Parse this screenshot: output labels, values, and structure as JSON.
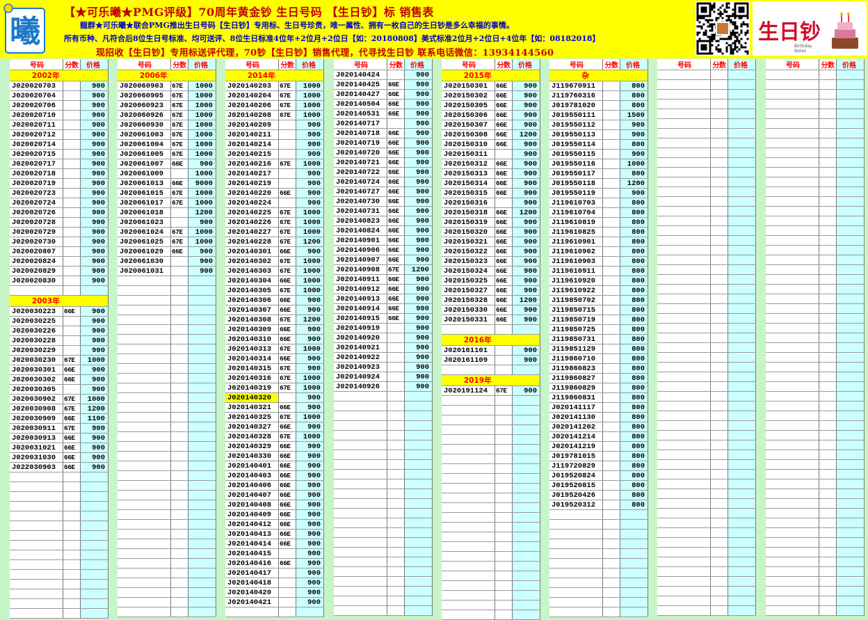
{
  "header": {
    "line1": "【★可乐曦★PMG评级】70周年黄金钞 生日号码  【生日钞】标  销售表",
    "line2": "龍群★可乐曦★联合PMG推出生日号码【生日钞】专用标、生日号珍贵，唯一属性、拥有一枚自己的生日钞是多么幸福的事情。",
    "line3": "所有币种、凡符合后8位生日号标准、均可送评、8位生日标准4位年+2位月+2位日【如：20180808】美式标准2位月+2位日+4位年【如：08182018】",
    "line4": "现招收【生日钞】专用标送评代理，70钞【生日钞】销售代理，代寻找生日钞 联系电话微信：13934144560",
    "logo_left_char": "曦",
    "logo_right_text": "生日钞",
    "logo_right_sub1": "Birthday",
    "logo_right_sub2": "Notes"
  },
  "labels": {
    "code": "号码",
    "score": "分数",
    "price": "价格"
  },
  "columns": [
    {
      "rows": [
        {
          "year": "2002年"
        },
        [
          "J020020703",
          "",
          "900"
        ],
        [
          "J020020704",
          "",
          "900"
        ],
        [
          "J020020706",
          "",
          "900"
        ],
        [
          "J020020710",
          "",
          "900"
        ],
        [
          "J020020711",
          "",
          "900"
        ],
        [
          "J020020712",
          "",
          "900"
        ],
        [
          "J020020714",
          "",
          "900"
        ],
        [
          "J020020715",
          "",
          "900"
        ],
        [
          "J020020717",
          "",
          "900"
        ],
        [
          "J020020718",
          "",
          "900"
        ],
        [
          "J020020719",
          "",
          "900"
        ],
        [
          "J020020723",
          "",
          "900"
        ],
        [
          "J020020724",
          "",
          "900"
        ],
        [
          "J020020726",
          "",
          "900"
        ],
        [
          "J020020728",
          "",
          "900"
        ],
        [
          "J020020729",
          "",
          "900"
        ],
        [
          "J020020730",
          "",
          "900"
        ],
        [
          "J020020807",
          "",
          "900"
        ],
        [
          "J020020824",
          "",
          "900"
        ],
        [
          "J020020829",
          "",
          "900"
        ],
        [
          "J020020830",
          "",
          "900"
        ],
        [
          "",
          "",
          ""
        ],
        {
          "year": "2003年"
        },
        [
          "J020030223",
          "66E",
          "900"
        ],
        [
          "J020030225",
          "",
          "900"
        ],
        [
          "J020030226",
          "",
          "900"
        ],
        [
          "J020030228",
          "",
          "900"
        ],
        [
          "J020030229",
          "",
          "900"
        ],
        [
          "J020030230",
          "67E",
          "1000"
        ],
        [
          "J020030301",
          "66E",
          "900"
        ],
        [
          "J020030302",
          "66E",
          "900"
        ],
        [
          "J020030305",
          "",
          "900"
        ],
        [
          "J020030902",
          "67E",
          "1000"
        ],
        [
          "J020030908",
          "67E",
          "1200"
        ],
        [
          "J020030909",
          "66E",
          "1100"
        ],
        [
          "J020030911",
          "67E",
          "900"
        ],
        [
          "J020030913",
          "66E",
          "900"
        ],
        [
          "J020031021",
          "66E",
          "900"
        ],
        [
          "J020031030",
          "66E",
          "900"
        ],
        [
          "J022030903",
          "66E",
          "900"
        ]
      ]
    },
    {
      "rows": [
        {
          "year": "2006年"
        },
        [
          "J020060903",
          "67E",
          "1000"
        ],
        [
          "J020060905",
          "67E",
          "1000"
        ],
        [
          "J020060923",
          "67E",
          "1000"
        ],
        [
          "J020060926",
          "67E",
          "1000"
        ],
        [
          "J020060930",
          "67E",
          "1000"
        ],
        [
          "J020061003",
          "67E",
          "1000"
        ],
        [
          "J020061004",
          "67E",
          "1000"
        ],
        [
          "J020061005",
          "67E",
          "1000"
        ],
        [
          "J020061007",
          "66E",
          "900"
        ],
        [
          "J020061009",
          "",
          "1000"
        ],
        [
          "J020061013",
          "66E",
          "9000"
        ],
        [
          "J020061015",
          "67E",
          "1000"
        ],
        [
          "J020061017",
          "67E",
          "1000"
        ],
        [
          "J020061018",
          "",
          "1200"
        ],
        [
          "J020061023",
          "",
          "900"
        ],
        [
          "J020061024",
          "67E",
          "1000"
        ],
        [
          "J020061025",
          "67E",
          "1000"
        ],
        [
          "J020061029",
          "66E",
          "900"
        ],
        [
          "J020061030",
          "",
          "900"
        ],
        [
          "J020061031",
          "",
          "900"
        ]
      ]
    },
    {
      "rows": [
        {
          "year": "2014年"
        },
        [
          "J020140203",
          "67E",
          "1000"
        ],
        [
          "J020140204",
          "67E",
          "1000"
        ],
        [
          "J020140206",
          "67E",
          "1000"
        ],
        [
          "J020140208",
          "67E",
          "1000"
        ],
        [
          "J020140209",
          "",
          "900"
        ],
        [
          "J020140211",
          "",
          "900"
        ],
        [
          "J020140214",
          "",
          "900"
        ],
        [
          "J020140215",
          "",
          "900"
        ],
        [
          "J020140216",
          "67E",
          "1000"
        ],
        [
          "J020140217",
          "",
          "900"
        ],
        [
          "J020140219",
          "",
          "900"
        ],
        [
          "J020140220",
          "66E",
          "900"
        ],
        [
          "J020140224",
          "",
          "900"
        ],
        [
          "J020140225",
          "67E",
          "1000"
        ],
        [
          "J020140226",
          "67E",
          "1000"
        ],
        [
          "J020140227",
          "67E",
          "1000"
        ],
        [
          "J020140228",
          "67E",
          "1200"
        ],
        [
          "J020140301",
          "66E",
          "900"
        ],
        [
          "J020140302",
          "67E",
          "1000"
        ],
        [
          "J020140303",
          "67E",
          "1000"
        ],
        [
          "J020140304",
          "66E",
          "1000"
        ],
        [
          "J020140305",
          "67E",
          "1000"
        ],
        [
          "J020140306",
          "66E",
          "900"
        ],
        [
          "J020140307",
          "66E",
          "900"
        ],
        [
          "J020140308",
          "67E",
          "1200"
        ],
        [
          "J020140309",
          "66E",
          "900"
        ],
        [
          "J020140310",
          "66E",
          "900"
        ],
        [
          "J020140313",
          "67E",
          "1000"
        ],
        [
          "J020140314",
          "66E",
          "900"
        ],
        [
          "J020140315",
          "67E",
          "900"
        ],
        [
          "J020140316",
          "67E",
          "1000"
        ],
        [
          "J020140319",
          "67E",
          "1000"
        ],
        [
          "J020140320",
          "",
          "900"
        ],
        [
          "J020140321",
          "66E",
          "900"
        ],
        [
          "J020140325",
          "67E",
          "1000"
        ],
        [
          "J020140327",
          "66E",
          "900"
        ],
        [
          "J020140328",
          "67E",
          "1000"
        ],
        [
          "J020140329",
          "66E",
          "900"
        ],
        [
          "J020140330",
          "66E",
          "900"
        ],
        [
          "J020140401",
          "66E",
          "900"
        ],
        [
          "J020140403",
          "66E",
          "900"
        ],
        [
          "J020140406",
          "66E",
          "900"
        ],
        [
          "J020140407",
          "66E",
          "900"
        ],
        [
          "J020140408",
          "66E",
          "900"
        ],
        [
          "J020140409",
          "66E",
          "900"
        ],
        [
          "J020140412",
          "66E",
          "900"
        ],
        [
          "J020140413",
          "66E",
          "900"
        ],
        [
          "J020140414",
          "66E",
          "900"
        ],
        [
          "J020140415",
          "",
          "900"
        ],
        [
          "J020140416",
          "66E",
          "900"
        ],
        [
          "J020140417",
          "",
          "900"
        ],
        [
          "J020140418",
          "",
          "900"
        ],
        [
          "J020140420",
          "",
          "900"
        ],
        [
          "J020140421",
          "",
          "900"
        ]
      ]
    },
    {
      "rows": [
        [
          "J020140424",
          "",
          "900"
        ],
        [
          "J020140425",
          "66E",
          "900"
        ],
        [
          "J020140427",
          "66E",
          "900"
        ],
        [
          "J020140504",
          "66E",
          "900"
        ],
        [
          "J020140531",
          "66E",
          "900"
        ],
        [
          "J020140717",
          "",
          "900"
        ],
        [
          "J020140718",
          "66E",
          "900"
        ],
        [
          "J020140719",
          "66E",
          "900"
        ],
        [
          "J020140720",
          "66E",
          "900"
        ],
        [
          "J020140721",
          "66E",
          "900"
        ],
        [
          "J020140722",
          "66E",
          "900"
        ],
        [
          "J020140724",
          "66E",
          "900"
        ],
        [
          "J020140727",
          "66E",
          "900"
        ],
        [
          "J020140730",
          "66E",
          "900"
        ],
        [
          "J020140731",
          "66E",
          "900"
        ],
        [
          "J020140823",
          "66E",
          "900"
        ],
        [
          "J020140824",
          "66E",
          "900"
        ],
        [
          "J020140901",
          "66E",
          "900"
        ],
        [
          "J020140906",
          "66E",
          "900"
        ],
        [
          "J020140907",
          "66E",
          "900"
        ],
        [
          "J020140908",
          "67E",
          "1200"
        ],
        [
          "J020140911",
          "66E",
          "900"
        ],
        [
          "J020140912",
          "66E",
          "900"
        ],
        [
          "J020140913",
          "66E",
          "900"
        ],
        [
          "J020140914",
          "66E",
          "900"
        ],
        [
          "J020140915",
          "66E",
          "900"
        ],
        [
          "J020140919",
          "",
          "900"
        ],
        [
          "J020140920",
          "",
          "900"
        ],
        [
          "J020140921",
          "",
          "900"
        ],
        [
          "J020140922",
          "",
          "900"
        ],
        [
          "J020140923",
          "",
          "900"
        ],
        [
          "J020140924",
          "",
          "900"
        ],
        [
          "J020140926",
          "",
          "900"
        ]
      ]
    },
    {
      "rows": [
        {
          "year": "2015年"
        },
        [
          "J020150301",
          "66E",
          "900"
        ],
        [
          "J020150302",
          "66E",
          "900"
        ],
        [
          "J020150305",
          "66E",
          "900"
        ],
        [
          "J020150306",
          "66E",
          "900"
        ],
        [
          "J020150307",
          "66E",
          "900"
        ],
        [
          "J020150308",
          "66E",
          "1200"
        ],
        [
          "J020150310",
          "66E",
          "900"
        ],
        [
          "J020150311",
          "",
          "900"
        ],
        [
          "J020150312",
          "66E",
          "900"
        ],
        [
          "J020150313",
          "66E",
          "900"
        ],
        [
          "J020150314",
          "66E",
          "900"
        ],
        [
          "J020150315",
          "66E",
          "900"
        ],
        [
          "J020150316",
          "",
          "900"
        ],
        [
          "J020150318",
          "66E",
          "1200"
        ],
        [
          "J020150319",
          "66E",
          "900"
        ],
        [
          "J020150320",
          "66E",
          "900"
        ],
        [
          "J020150321",
          "66E",
          "900"
        ],
        [
          "J020150322",
          "66E",
          "900"
        ],
        [
          "J020150323",
          "66E",
          "900"
        ],
        [
          "J020150324",
          "66E",
          "900"
        ],
        [
          "J020150325",
          "66E",
          "900"
        ],
        [
          "J020150327",
          "66E",
          "900"
        ],
        [
          "J020150328",
          "66E",
          "1200"
        ],
        [
          "J020150330",
          "66E",
          "900"
        ],
        [
          "J020150331",
          "66E",
          "900"
        ],
        [
          "",
          "",
          ""
        ],
        {
          "year": "2016年"
        },
        [
          "J020161101",
          "",
          "900"
        ],
        [
          "J020161109",
          "",
          "900"
        ],
        [
          "",
          "",
          ""
        ],
        {
          "year": "2019年"
        },
        [
          "J020191124",
          "67E",
          "900"
        ]
      ]
    },
    {
      "rows": [
        {
          "year": "杂"
        },
        [
          "J119670911",
          "",
          "800"
        ],
        [
          "J119760316",
          "",
          "800"
        ],
        [
          "J019781020",
          "",
          "800"
        ],
        [
          "J019550111",
          "",
          "1500"
        ],
        [
          "J019550112",
          "",
          "900"
        ],
        [
          "J019550113",
          "",
          "900"
        ],
        [
          "J019550114",
          "",
          "800"
        ],
        [
          "J019550115",
          "",
          "900"
        ],
        [
          "J019550116",
          "",
          "1000"
        ],
        [
          "J019550117",
          "",
          "800"
        ],
        [
          "J019550118",
          "",
          "1200"
        ],
        [
          "J019550119",
          "",
          "900"
        ],
        [
          "J119610703",
          "",
          "800"
        ],
        [
          "J119610704",
          "",
          "800"
        ],
        [
          "J119610819",
          "",
          "800"
        ],
        [
          "J119610825",
          "",
          "800"
        ],
        [
          "J119610901",
          "",
          "800"
        ],
        [
          "J119610902",
          "",
          "800"
        ],
        [
          "J119610903",
          "",
          "800"
        ],
        [
          "J119610911",
          "",
          "800"
        ],
        [
          "J119610920",
          "",
          "800"
        ],
        [
          "J119610922",
          "",
          "800"
        ],
        [
          "J119850702",
          "",
          "800"
        ],
        [
          "J119850715",
          "",
          "800"
        ],
        [
          "J119850719",
          "",
          "800"
        ],
        [
          "J119850725",
          "",
          "800"
        ],
        [
          "J119850731",
          "",
          "800"
        ],
        [
          "J119851129",
          "",
          "800"
        ],
        [
          "J119860710",
          "",
          "800"
        ],
        [
          "J119860823",
          "",
          "800"
        ],
        [
          "J119860827",
          "",
          "800"
        ],
        [
          "J119860829",
          "",
          "800"
        ],
        [
          "J119860831",
          "",
          "800"
        ],
        [
          "J020141117",
          "",
          "800"
        ],
        [
          "J020141130",
          "",
          "800"
        ],
        [
          "J020141202",
          "",
          "800"
        ],
        [
          "J020141214",
          "",
          "800"
        ],
        [
          "J020141219",
          "",
          "800"
        ],
        [
          "J019781015",
          "",
          "800"
        ],
        [
          "J119720829",
          "",
          "800"
        ],
        [
          "J019520824",
          "",
          "800"
        ],
        [
          "J019520815",
          "",
          "800"
        ],
        [
          "J019520426",
          "",
          "800"
        ],
        [
          "J019520312",
          "",
          "800"
        ]
      ]
    },
    {
      "rows": []
    },
    {
      "rows": []
    }
  ],
  "highlight_code": "J020140320"
}
